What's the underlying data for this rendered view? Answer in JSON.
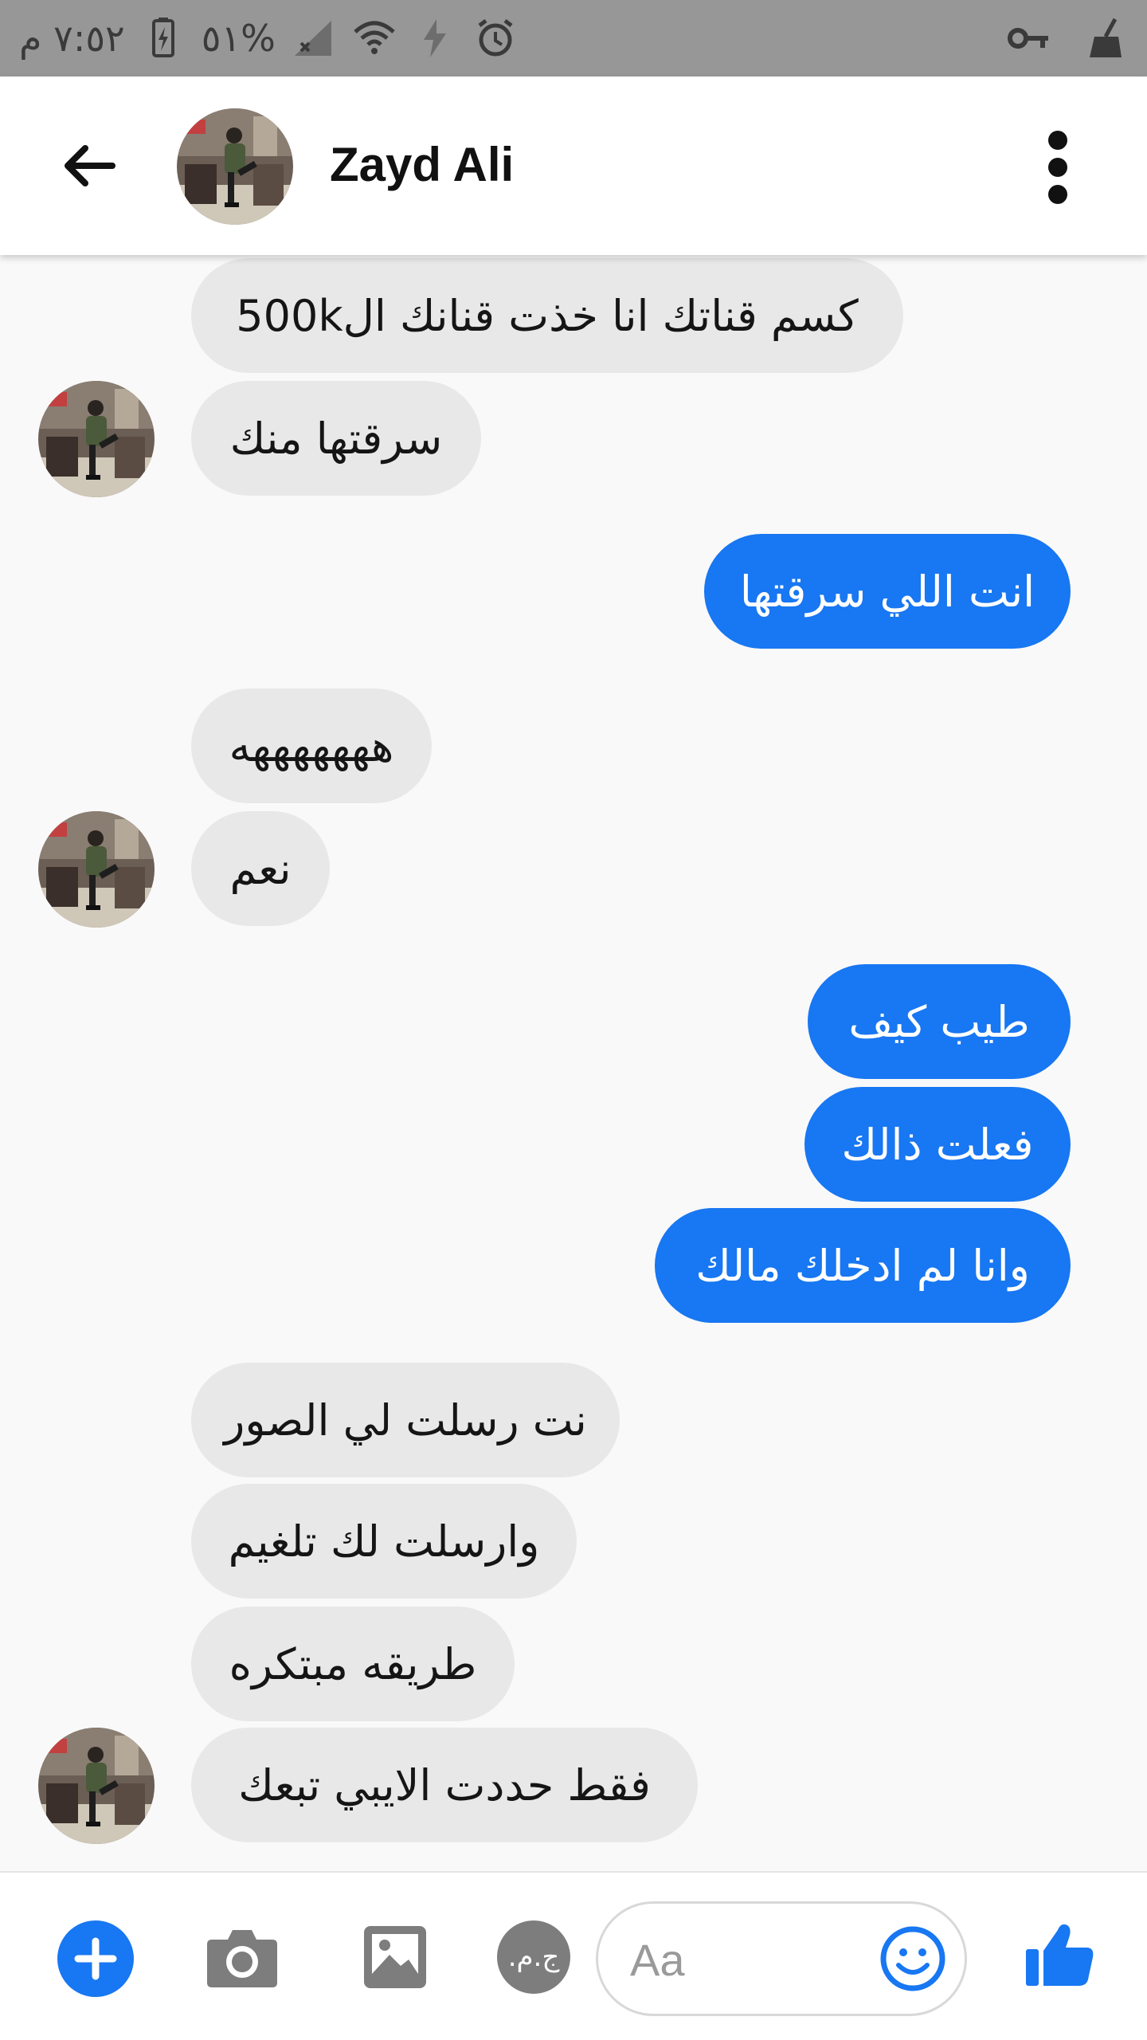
{
  "status_bar": {
    "time": "٧:٥٢ م",
    "battery_percent": "%٥١",
    "icons": [
      "battery-icon",
      "signal-icon",
      "wifi-icon",
      "data-icon",
      "alarm-icon",
      "vpn-key-icon",
      "broom-icon"
    ]
  },
  "header": {
    "contact_name": "Zayd Ali",
    "back_icon": "arrow-left-icon",
    "more_icon": "more-vertical-icon"
  },
  "messages": [
    {
      "direction": "in",
      "text": "كسم قناتك انا خذت قنانك ال500k"
    },
    {
      "direction": "in",
      "text": "سرقتها منك"
    },
    {
      "direction": "out",
      "text": "انت اللي سرقتها"
    },
    {
      "direction": "in",
      "text": "هههههههه"
    },
    {
      "direction": "in",
      "text": "نعم"
    },
    {
      "direction": "out",
      "text": "طيب كيف"
    },
    {
      "direction": "out",
      "text": "فعلت ذالك"
    },
    {
      "direction": "out",
      "text": "وانا لم ادخلك مالك"
    },
    {
      "direction": "in",
      "text": "نت رسلت لي الصور"
    },
    {
      "direction": "in",
      "text": "وارسلت لك تلغيم"
    },
    {
      "direction": "in",
      "text": "طريقه مبتكره"
    },
    {
      "direction": "in",
      "text": "فقط حددت الايبي تبعك"
    }
  ],
  "composer": {
    "placeholder": "Aa",
    "sticker_label": "ج.م.",
    "icons": [
      "plus-icon",
      "camera-icon",
      "gallery-icon",
      "emoji-icon",
      "thumbs-up-icon"
    ]
  },
  "colors": {
    "accent": "#1877f2",
    "incoming_bubble": "#e8e8e8",
    "status_bar": "#979797"
  }
}
